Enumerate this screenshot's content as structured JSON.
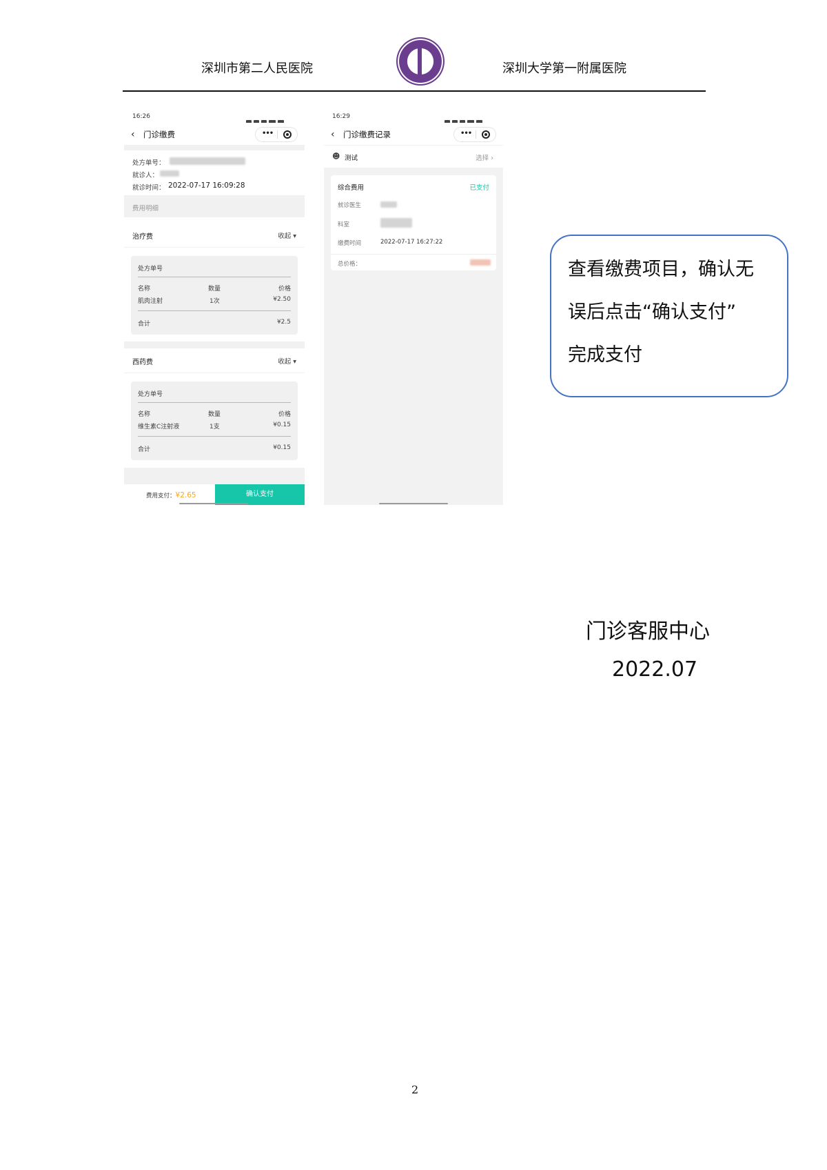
{
  "header": {
    "left_hospital": "深圳市第二人民医院",
    "right_hospital": "深圳大学第一附属医院"
  },
  "screen1": {
    "time": "16:26",
    "title": "门诊缴费",
    "prescription_no_label": "处方单号：",
    "patient_label": "就诊人：",
    "visit_time_label": "就诊时间：",
    "visit_time_value": "2022-07-17 16:09:28",
    "fee_detail_label": "费用明细",
    "sections": [
      {
        "name": "治疗费",
        "toggle": "收起",
        "card": {
          "prescription_label": "处方单号",
          "col_name": "名称",
          "col_qty": "数量",
          "col_price": "价格",
          "item_name": "肌肉注射",
          "item_qty": "1次",
          "item_price": "¥2.50",
          "total_label": "合计",
          "total_value": "¥2.5"
        }
      },
      {
        "name": "西药费",
        "toggle": "收起",
        "card": {
          "prescription_label": "处方单号",
          "col_name": "名称",
          "col_qty": "数量",
          "col_price": "价格",
          "item_name": "维生素C注射液",
          "item_qty": "1支",
          "item_price": "¥0.15",
          "total_label": "合计",
          "total_value": "¥0.15"
        }
      }
    ],
    "pay_label": "费用支付：",
    "pay_amount": "¥2.65",
    "confirm_button": "确认支付"
  },
  "screen2": {
    "time": "16:29",
    "title": "门诊缴费记录",
    "patient_name": "测试",
    "select_label": "选择",
    "record": {
      "type": "综合费用",
      "status": "已支付",
      "doctor_label": "就诊医生",
      "dept_label": "科室",
      "pay_time_label": "缴费时间",
      "pay_time_value": "2022-07-17 16:27:22",
      "total_label": "总价格："
    }
  },
  "callout": {
    "lines": [
      "查看缴费项目，确认无",
      "误后点击“确认支付”",
      "完成支付"
    ]
  },
  "footer": {
    "department": "门诊客服中心",
    "date": "2022.07"
  },
  "page_number": "2",
  "colors": {
    "accent_teal": "#17c5a8",
    "amount_orange": "#f5a623",
    "callout_border": "#4472c4",
    "logo_purple": "#6a3d8f"
  }
}
